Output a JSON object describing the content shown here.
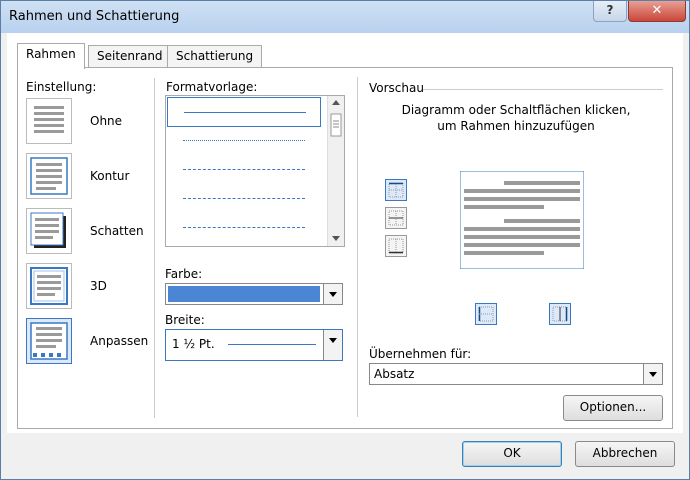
{
  "window": {
    "title": "Rahmen und Schattierung",
    "help_label": "?",
    "close_label": "✕"
  },
  "tabs": [
    {
      "label": "Rahmen",
      "active": true
    },
    {
      "label": "Seitenrand",
      "active": false
    },
    {
      "label": "Schattierung",
      "active": false
    }
  ],
  "einstellung": {
    "label": "Einstellung:",
    "items": [
      {
        "label": "Ohne",
        "icon": "border-none-icon"
      },
      {
        "label": "Kontur",
        "icon": "border-box-icon"
      },
      {
        "label": "Schatten",
        "icon": "border-shadow-icon"
      },
      {
        "label": "3D",
        "icon": "border-3d-icon"
      },
      {
        "label": "Anpassen",
        "icon": "border-custom-icon",
        "selected": true
      }
    ]
  },
  "formatvorlage": {
    "label": "Formatvorlage:",
    "styles": [
      "solid",
      "dotted",
      "dashed-small",
      "dashed",
      "dash-dot"
    ],
    "selected_index": 0
  },
  "farbe": {
    "label": "Farbe:",
    "value_color": "#4a86d4"
  },
  "breite": {
    "label": "Breite:",
    "value": "1 ½ Pt."
  },
  "vorschau": {
    "label": "Vorschau",
    "hint_line1": "Diagramm oder Schaltflächen klicken,",
    "hint_line2": "um Rahmen hinzuzufügen"
  },
  "uebernehmen": {
    "label": "Übernehmen für:",
    "value": "Absatz"
  },
  "buttons": {
    "optionen": "Optionen...",
    "ok": "OK",
    "abbrechen": "Abbrechen"
  },
  "colors": {
    "accent": "#3a78c3",
    "border_line": "#4a86d4"
  }
}
